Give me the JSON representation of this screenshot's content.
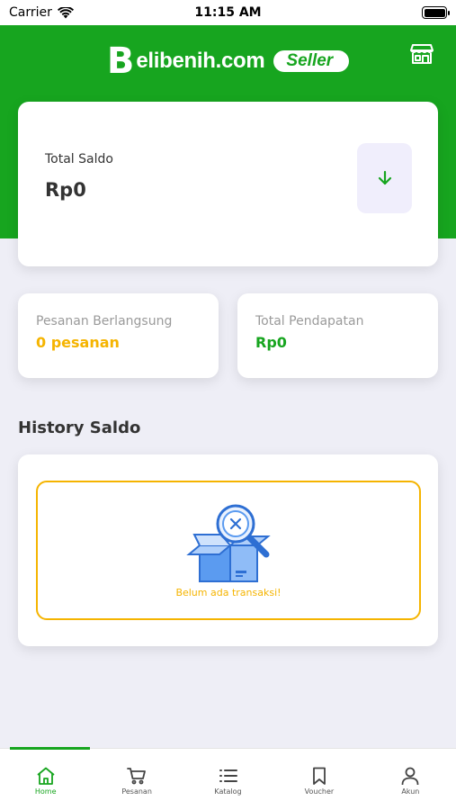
{
  "status_bar": {
    "carrier": "Carrier",
    "time": "11:15 AM"
  },
  "header": {
    "logo_letter": "B",
    "logo_text": "elibenih.com",
    "badge": "Seller",
    "store_icon": "store-icon"
  },
  "balance": {
    "label": "Total Saldo",
    "value": "Rp0",
    "action_icon": "arrow-down-icon"
  },
  "stats": {
    "orders": {
      "label": "Pesanan Berlangsung",
      "value": "0 pesanan"
    },
    "income": {
      "label": "Total Pendapatan",
      "value": "Rp0"
    }
  },
  "history": {
    "title": "History Saldo",
    "empty_text": "Belum ada transaksi!",
    "empty_icon": "empty-box-search-icon"
  },
  "nav": {
    "items": [
      {
        "label": "Home",
        "icon": "home-icon",
        "active": true
      },
      {
        "label": "Pesanan",
        "icon": "cart-icon",
        "active": false
      },
      {
        "label": "Katalog",
        "icon": "list-icon",
        "active": false
      },
      {
        "label": "Voucher",
        "icon": "bookmark-icon",
        "active": false
      },
      {
        "label": "Akun",
        "icon": "user-icon",
        "active": false
      }
    ]
  },
  "colors": {
    "brand_green": "#17A51F",
    "accent_orange": "#F5B400",
    "background": "#EEEEF6"
  }
}
